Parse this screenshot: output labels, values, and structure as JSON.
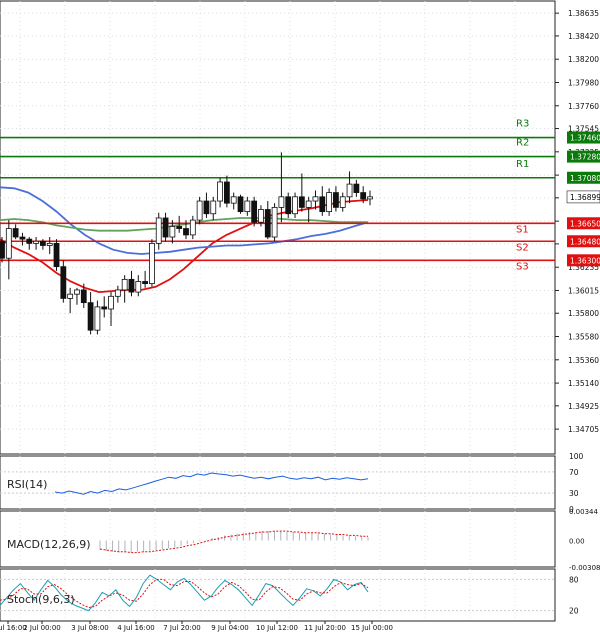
{
  "chart_data": [
    {
      "type": "candlestick",
      "title": "",
      "ylim": [
        1.3447,
        1.3875
      ],
      "y_ticks": [
        "1.38635",
        "1.38420",
        "1.38200",
        "1.37980",
        "1.37760",
        "1.37545",
        "1.37325",
        "1.37105",
        "1.36890",
        "1.36670",
        "1.36455",
        "1.36235",
        "1.36015",
        "1.35800",
        "1.35580",
        "1.35360",
        "1.35140",
        "1.34925",
        "1.34705"
      ],
      "x_tick_labels": [
        "1 Jul 16:00",
        "2 Jul 00:00",
        "3 Jul 08:00",
        "4 Jul 16:00",
        "7 Jul 20:00",
        "9 Jul 04:00",
        "10 Jul 12:00",
        "11 Jul 20:00",
        "15 Jul 00:00"
      ],
      "last_price": 1.36899,
      "levels": [
        {
          "label": "R3",
          "price": 1.3746,
          "price_text": "1.37460",
          "color": "#0a7a0a"
        },
        {
          "label": "R2",
          "price": 1.3728,
          "price_text": "1.37280",
          "color": "#0a7a0a"
        },
        {
          "label": "R1",
          "price": 1.3708,
          "price_text": "1.37080",
          "color": "#0a7a0a"
        },
        {
          "label": "S1",
          "price": 1.3665,
          "price_text": "1.36650",
          "color": "#e01010"
        },
        {
          "label": "S2",
          "price": 1.3648,
          "price_text": "1.36480",
          "color": "#e01010"
        },
        {
          "label": "S3",
          "price": 1.363,
          "price_text": "1.36300",
          "color": "#e01010"
        }
      ],
      "candles": [
        [
          1.3648,
          1.3652,
          1.3628,
          1.3632
        ],
        [
          1.3632,
          1.3668,
          1.3612,
          1.366
        ],
        [
          1.366,
          1.3664,
          1.365,
          1.3652
        ],
        [
          1.3652,
          1.3656,
          1.3644,
          1.365
        ],
        [
          1.365,
          1.3652,
          1.364,
          1.3646
        ],
        [
          1.3646,
          1.3652,
          1.364,
          1.3648
        ],
        [
          1.3648,
          1.365,
          1.364,
          1.3644
        ],
        [
          1.3644,
          1.3652,
          1.3636,
          1.3646
        ],
        [
          1.3646,
          1.365,
          1.362,
          1.3624
        ],
        [
          1.3624,
          1.363,
          1.359,
          1.3594
        ],
        [
          1.3594,
          1.3604,
          1.358,
          1.3598
        ],
        [
          1.3598,
          1.3604,
          1.3588,
          1.3602
        ],
        [
          1.3602,
          1.3608,
          1.3585,
          1.359
        ],
        [
          1.359,
          1.36,
          1.356,
          1.3564
        ],
        [
          1.3564,
          1.3592,
          1.356,
          1.3586
        ],
        [
          1.3586,
          1.3596,
          1.3576,
          1.3584
        ],
        [
          1.3584,
          1.36,
          1.3568,
          1.3596
        ],
        [
          1.3596,
          1.3606,
          1.359,
          1.3602
        ],
        [
          1.3602,
          1.3616,
          1.359,
          1.3612
        ],
        [
          1.3612,
          1.362,
          1.3596,
          1.36
        ],
        [
          1.36,
          1.3616,
          1.3596,
          1.361
        ],
        [
          1.361,
          1.362,
          1.3604,
          1.3608
        ],
        [
          1.3608,
          1.365,
          1.3605,
          1.3646
        ],
        [
          1.3646,
          1.3675,
          1.364,
          1.367
        ],
        [
          1.367,
          1.3675,
          1.3648,
          1.3652
        ],
        [
          1.3652,
          1.3668,
          1.3646,
          1.3662
        ],
        [
          1.3662,
          1.3672,
          1.3656,
          1.366
        ],
        [
          1.366,
          1.3668,
          1.365,
          1.3654
        ],
        [
          1.3654,
          1.3672,
          1.365,
          1.3668
        ],
        [
          1.3668,
          1.369,
          1.3664,
          1.3686
        ],
        [
          1.3686,
          1.3694,
          1.367,
          1.3674
        ],
        [
          1.3674,
          1.369,
          1.3668,
          1.3686
        ],
        [
          1.3686,
          1.3708,
          1.368,
          1.3704
        ],
        [
          1.3704,
          1.371,
          1.368,
          1.3684
        ],
        [
          1.3684,
          1.3694,
          1.3678,
          1.369
        ],
        [
          1.369,
          1.3692,
          1.3674,
          1.3676
        ],
        [
          1.3676,
          1.369,
          1.3672,
          1.3686
        ],
        [
          1.3686,
          1.369,
          1.3662,
          1.3666
        ],
        [
          1.3666,
          1.3682,
          1.3662,
          1.3678
        ],
        [
          1.3678,
          1.3686,
          1.365,
          1.3652
        ],
        [
          1.3652,
          1.3684,
          1.3648,
          1.368
        ],
        [
          1.368,
          1.3732,
          1.3666,
          1.369
        ],
        [
          1.369,
          1.3694,
          1.367,
          1.3674
        ],
        [
          1.3674,
          1.3694,
          1.367,
          1.369
        ],
        [
          1.369,
          1.3712,
          1.3676,
          1.368
        ],
        [
          1.368,
          1.369,
          1.3666,
          1.3686
        ],
        [
          1.3686,
          1.3696,
          1.3678,
          1.369
        ],
        [
          1.369,
          1.37,
          1.3672,
          1.3676
        ],
        [
          1.3676,
          1.3698,
          1.3672,
          1.3694
        ],
        [
          1.3694,
          1.37,
          1.3676,
          1.368
        ],
        [
          1.368,
          1.3694,
          1.3676,
          1.369
        ],
        [
          1.369,
          1.3714,
          1.3684,
          1.3702
        ],
        [
          1.3702,
          1.3706,
          1.369,
          1.3694
        ],
        [
          1.3694,
          1.37,
          1.3684,
          1.3688
        ],
        [
          1.3688,
          1.3696,
          1.3682,
          1.369
        ]
      ],
      "ma_series": [
        {
          "color": "#e01010",
          "values": [
            1.365,
            1.3642,
            1.3636,
            1.3628,
            1.3618,
            1.361,
            1.3604,
            1.36,
            1.3601,
            1.3602,
            1.3602,
            1.3605,
            1.3612,
            1.3622,
            1.3634,
            1.3646,
            1.3654,
            1.366,
            1.3666,
            1.3672,
            1.3675,
            1.3677,
            1.3679,
            1.3682,
            1.3685,
            1.3686,
            1.3687
          ]
        },
        {
          "color": "#4a6fd8",
          "values": [
            1.3699,
            1.3698,
            1.3694,
            1.3686,
            1.3676,
            1.3664,
            1.3654,
            1.3646,
            1.364,
            1.3637,
            1.3636,
            1.3637,
            1.3638,
            1.364,
            1.3642,
            1.3643,
            1.3644,
            1.3644,
            1.3645,
            1.3646,
            1.3648,
            1.365,
            1.3653,
            1.3655,
            1.3658,
            1.3662,
            1.3666
          ]
        },
        {
          "color": "#5fa35f",
          "values": [
            1.3668,
            1.3669,
            1.3668,
            1.3666,
            1.3663,
            1.3661,
            1.3659,
            1.3658,
            1.3658,
            1.3658,
            1.3659,
            1.366,
            1.3662,
            1.3664,
            1.3666,
            1.3668,
            1.3669,
            1.367,
            1.367,
            1.367,
            1.3669,
            1.3668,
            1.3668,
            1.3667,
            1.3666,
            1.3666,
            1.3666
          ]
        }
      ]
    },
    {
      "type": "line",
      "title": "RSI(14)",
      "y_ticks": [
        "100",
        "70",
        "30",
        "0"
      ],
      "ylim": [
        0,
        100
      ],
      "series": [
        {
          "color": "#1a5fe0",
          "values": [
            32,
            30,
            34,
            31,
            28,
            33,
            30,
            35,
            33,
            38,
            36,
            40,
            44,
            48,
            52,
            56,
            60,
            58,
            63,
            61,
            66,
            64,
            68,
            66,
            65,
            62,
            64,
            61,
            58,
            60,
            57,
            60,
            62,
            58,
            56,
            59,
            57,
            60,
            55,
            58,
            56,
            59,
            57,
            55,
            57
          ]
        }
      ]
    },
    {
      "type": "bar",
      "title": "MACD(12,26,9)",
      "y_ticks": [
        "0.00344",
        "0.00",
        "-0.00308"
      ],
      "ylim": [
        -0.00308,
        0.00344
      ],
      "histogram": [
        -0.0011,
        -0.0012,
        -0.0013,
        -0.0014,
        -0.0014,
        -0.0014,
        -0.0013,
        -0.0013,
        -0.0012,
        -0.0011,
        -0.001,
        -0.0009,
        -0.0008,
        -0.0006,
        -0.0004,
        -0.0003,
        -0.0001,
        0.0001,
        0.0003,
        0.0004,
        0.0006,
        0.0007,
        0.0008,
        0.0009,
        0.001,
        0.001,
        0.0011,
        0.0011,
        0.0011,
        0.0011,
        0.001,
        0.001,
        0.0009,
        0.0009,
        0.0009,
        0.0008,
        0.0008,
        0.0007,
        0.0007,
        0.0006,
        0.0006,
        0.0005,
        0.0005,
        0.0004
      ],
      "signal": [
        -0.001,
        -0.0011,
        -0.0012,
        -0.0013,
        -0.0013,
        -0.0014,
        -0.0014,
        -0.0013,
        -0.0013,
        -0.0012,
        -0.0011,
        -0.001,
        -0.0009,
        -0.0008,
        -0.0006,
        -0.0005,
        -0.0003,
        -0.0001,
        0.0001,
        0.0002,
        0.0004,
        0.0005,
        0.0006,
        0.0007,
        0.0008,
        0.0009,
        0.001,
        0.001,
        0.0011,
        0.0011,
        0.0011,
        0.001,
        0.001,
        0.0009,
        0.0009,
        0.0009,
        0.0008,
        0.0008,
        0.0007,
        0.0007,
        0.0006,
        0.0006,
        0.0005,
        0.0005
      ],
      "signal_color": "#e01010"
    },
    {
      "type": "line",
      "title": "Stoch(9,6,3)",
      "y_ticks": [
        "80",
        "20"
      ],
      "ylim": [
        0,
        100
      ],
      "series": [
        {
          "color": "#1aa0b4",
          "values": [
            30,
            45,
            60,
            72,
            55,
            40,
            60,
            78,
            66,
            50,
            38,
            30,
            25,
            20,
            35,
            55,
            48,
            60,
            40,
            28,
            45,
            72,
            88,
            80,
            70,
            60,
            75,
            82,
            70,
            55,
            40,
            48,
            65,
            78,
            70,
            60,
            45,
            30,
            50,
            72,
            68,
            55,
            42,
            30,
            45,
            62,
            58,
            48,
            62,
            80,
            75,
            60,
            70,
            74,
            56
          ]
        },
        {
          "color": "#e01010",
          "values": [
            40,
            42,
            50,
            62,
            62,
            52,
            52,
            66,
            70,
            62,
            50,
            40,
            32,
            26,
            28,
            40,
            48,
            54,
            50,
            40,
            38,
            52,
            70,
            80,
            80,
            70,
            68,
            76,
            76,
            66,
            54,
            46,
            52,
            66,
            74,
            68,
            56,
            42,
            40,
            56,
            66,
            64,
            54,
            42,
            40,
            52,
            58,
            54,
            54,
            66,
            74,
            70,
            68,
            72,
            64
          ]
        }
      ]
    }
  ]
}
